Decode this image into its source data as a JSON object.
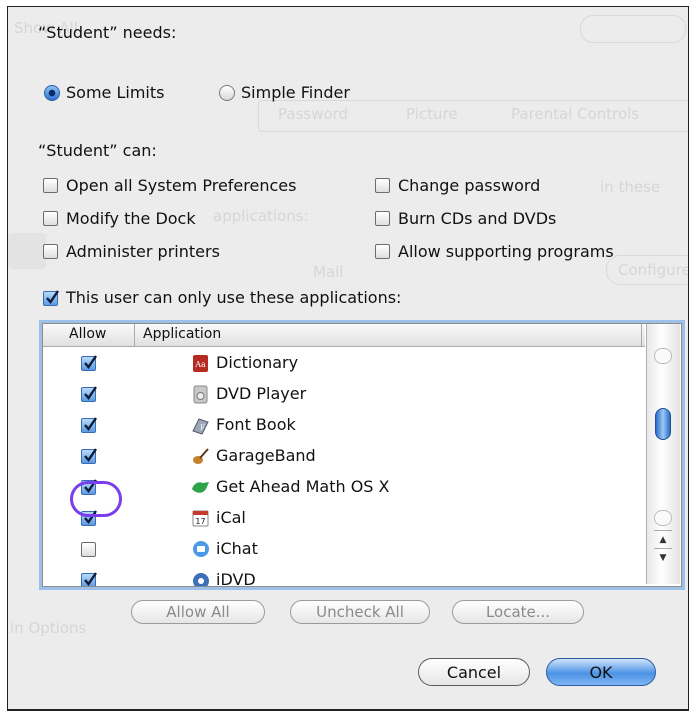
{
  "background": {
    "show_all": "Show All",
    "tabs": [
      "Password",
      "Picture",
      "Parental Controls"
    ],
    "fragment_in_these": "in these",
    "fragment_applications": "applications:",
    "fragment_mail": "Mail",
    "fragment_configure": "Configure",
    "fragment_options": "in Options"
  },
  "sheet": {
    "needs_label": "“Student” needs:",
    "radio_some_limits": "Some Limits",
    "radio_simple_finder": "Simple Finder",
    "radio_selected": "Some Limits",
    "can_label": "“Student” can:",
    "permissions": [
      {
        "label": "Open all System Preferences",
        "checked": false
      },
      {
        "label": "Change password",
        "checked": false
      },
      {
        "label": "Modify the Dock",
        "checked": false
      },
      {
        "label": "Burn CDs and DVDs",
        "checked": false
      },
      {
        "label": "Administer printers",
        "checked": false
      },
      {
        "label": "Allow supporting programs",
        "checked": false
      }
    ],
    "only_apps_label": "This user can only use these applications:",
    "only_apps_checked": true
  },
  "table": {
    "headers": {
      "allow": "Allow",
      "application": "Application"
    },
    "rows": [
      {
        "name": "Dictionary",
        "allowed": true,
        "icon": "dictionary-icon"
      },
      {
        "name": "DVD Player",
        "allowed": true,
        "icon": "dvd-player-icon"
      },
      {
        "name": "Font Book",
        "allowed": true,
        "icon": "font-book-icon"
      },
      {
        "name": "GarageBand",
        "allowed": true,
        "icon": "garageband-icon"
      },
      {
        "name": "Get Ahead Math OS X",
        "allowed": true,
        "icon": "get-ahead-math-icon"
      },
      {
        "name": "iCal",
        "allowed": true,
        "icon": "ical-icon"
      },
      {
        "name": "iChat",
        "allowed": false,
        "icon": "ichat-icon"
      },
      {
        "name": "iDVD",
        "allowed": true,
        "icon": "idvd-icon"
      }
    ]
  },
  "buttons": {
    "allow_all": "Allow All",
    "uncheck_all": "Uncheck All",
    "locate": "Locate...",
    "cancel": "Cancel",
    "ok": "OK"
  },
  "colors": {
    "accent": "#3a78d8",
    "highlight_ring": "#7a3df0"
  }
}
